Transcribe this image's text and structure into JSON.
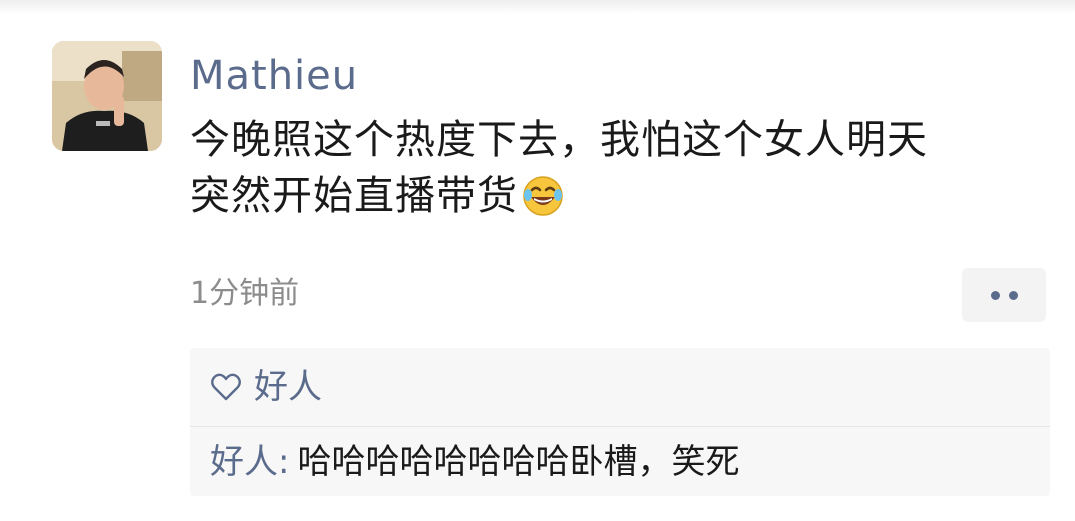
{
  "post": {
    "username": "Mathieu",
    "text_lines": [
      "今晚照这个热度下去，我怕这个女人明天",
      "突然开始直播带货"
    ],
    "emoji": "laughing-tears-emoji",
    "timestamp": "1分钟前"
  },
  "likes": {
    "icon": "heart-icon",
    "names": "好人"
  },
  "comments": [
    {
      "author": "好人",
      "separator": ":",
      "text": "哈哈哈哈哈哈哈哈卧槽，笑死"
    }
  ],
  "colors": {
    "link_blue": "#5b6b8c",
    "text_primary": "#1a1a1a",
    "text_secondary": "#8c8c8c",
    "panel_bg": "#f7f7f7"
  }
}
